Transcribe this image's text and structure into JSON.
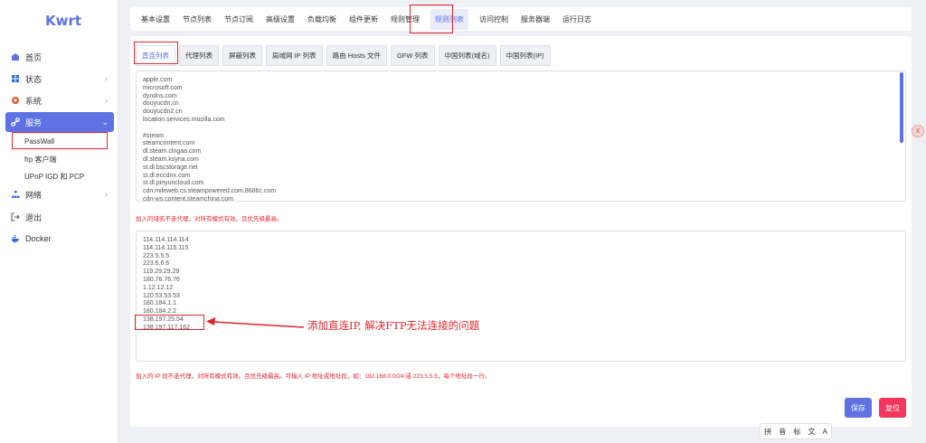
{
  "sidebar": {
    "logo": "Kwrt",
    "items": [
      {
        "label": "首页",
        "icon": "dashboard-icon"
      },
      {
        "label": "状态",
        "icon": "status-icon"
      },
      {
        "label": "系统",
        "icon": "gear-icon"
      },
      {
        "label": "服务",
        "icon": "link-icon"
      },
      {
        "label": "网络",
        "icon": "network-icon"
      },
      {
        "label": "退出",
        "icon": "logout-icon"
      },
      {
        "label": "Docker",
        "icon": "docker-icon"
      }
    ],
    "sub_items": [
      "PassWall",
      "frp 客户端",
      "UPnP IGD 和 PCP"
    ]
  },
  "top_tabs": [
    "基本设置",
    "节点列表",
    "节点订阅",
    "高级设置",
    "负载均衡",
    "组件更新",
    "规则管理",
    "规则列表",
    "访问控制",
    "服务器端",
    "运行日志"
  ],
  "sub_tabs": [
    "直连列表",
    "代理列表",
    "屏蔽列表",
    "局域网 IP 列表",
    "路由 Hosts 文件",
    "GFW 列表",
    "中国列表(域名)",
    "中国列表(IP)"
  ],
  "domain_list": [
    "apple.com",
    "microsoft.com",
    "dyndns.com",
    "douyucdn.cn",
    "douyucdn2.cn",
    "location.services.mozilla.com",
    "",
    "#steam",
    "steamcontent.com",
    "dl.steam.clngaa.com",
    "dl.steam.ksyna.com",
    "st.dl.bscstorage.net",
    "st.dl.eccdnx.com",
    "st.dl.pinyuncloud.com",
    "cdn.mileweb.cs.steampowered.com.8686c.com",
    "cdn-ws.content.steamchina.com"
  ],
  "domain_hint": "加入的域名不走代理，对所有模式有效。且优先级最高。",
  "ip_list": [
    "114.114.114.114",
    "114.114.115.115",
    "223.5.5.5",
    "223.6.6.6",
    "119.29.29.29",
    "180.76.76.76",
    "1.12.12.12",
    "120.53.53.53",
    "180.184.1.1",
    "180.184.2.2",
    "138.197.25.54",
    "138.197.117.162"
  ],
  "ip_hint": "加入的 IP 段不走代理，对所有模式有效。且优先级最高。可输入 IP 地址或地址段，如：192.168.0.0/24 或 223.5.5.5，每个地址段一行。",
  "buttons": {
    "save": "保存",
    "reset": "复位"
  },
  "annotation": "添加直连IP, 解决FTP无法连接的问题",
  "ime_bar": [
    "拼",
    "音",
    "标",
    "文",
    "A"
  ],
  "float_badge": "X",
  "colors": {
    "accent": "#5e72e4",
    "annotation": "#e3242b",
    "reset": "#f5365c"
  }
}
